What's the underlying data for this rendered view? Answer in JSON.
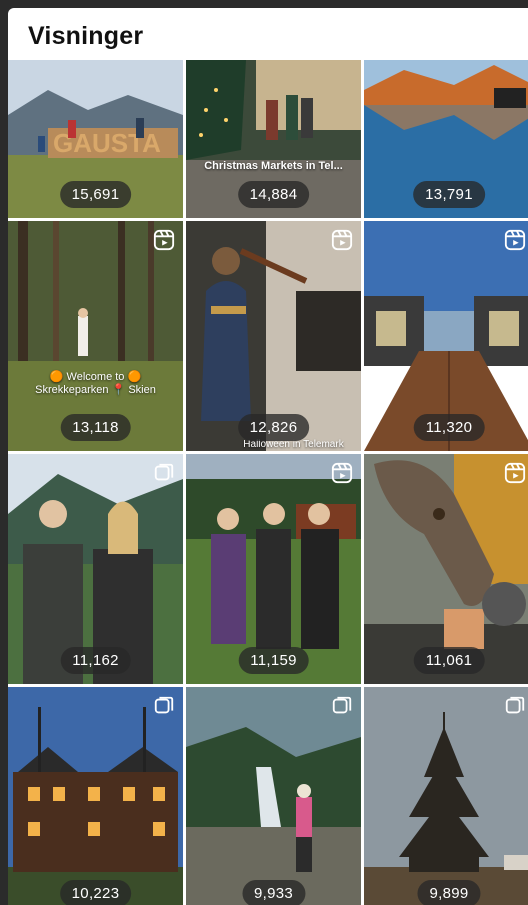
{
  "header": {
    "title": "Visninger"
  },
  "tiles": [
    {
      "views": "15,691",
      "icon": "none",
      "overlay": ""
    },
    {
      "views": "14,884",
      "icon": "none",
      "overlay": "Christmas Markets in Tel..."
    },
    {
      "views": "13,791",
      "icon": "none",
      "overlay": ""
    },
    {
      "views": "13,118",
      "icon": "reel-icon",
      "overlay": "🟠 Welcome to 🟠 Skrekkeparken 📍 Skien"
    },
    {
      "views": "12,826",
      "icon": "reel-icon",
      "overlay": "Halloween in Telemark"
    },
    {
      "views": "11,320",
      "icon": "reel-icon",
      "overlay": ""
    },
    {
      "views": "11,162",
      "icon": "multi-icon",
      "overlay": ""
    },
    {
      "views": "11,159",
      "icon": "reel-icon",
      "overlay": ""
    },
    {
      "views": "11,061",
      "icon": "reel-icon",
      "overlay": ""
    },
    {
      "views": "10,223",
      "icon": "multi-icon",
      "overlay": ""
    },
    {
      "views": "9,933",
      "icon": "multi-icon",
      "overlay": ""
    },
    {
      "views": "9,899",
      "icon": "multi-icon",
      "overlay": ""
    }
  ]
}
